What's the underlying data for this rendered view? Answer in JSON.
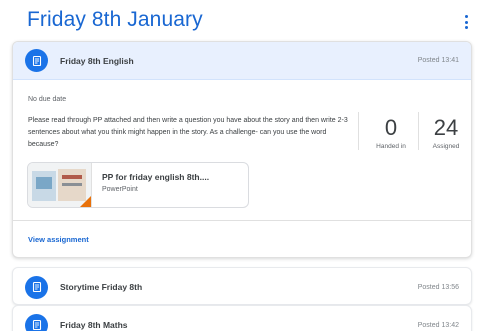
{
  "topic": {
    "title": "Friday 8th January"
  },
  "expanded_assignment": {
    "title": "Friday 8th English",
    "posted": "Posted 13:41",
    "due": "No due date",
    "instructions": "Please read through PP attached and then write a question you have about the story and then write 2-3 sentences about what you think might happen in the story. As a challenge- can you use the word because?",
    "handed_in_count": "0",
    "handed_in_label": "Handed in",
    "assigned_count": "24",
    "assigned_label": "Assigned",
    "attachment": {
      "title": "PP for friday english 8th....",
      "type": "PowerPoint"
    },
    "view_label": "View assignment"
  },
  "assignments": [
    {
      "title": "Storytime Friday 8th",
      "posted": "Posted 13:56"
    },
    {
      "title": "Friday 8th Maths",
      "posted": "Posted 13:42"
    }
  ],
  "colors": {
    "accent": "#1967d2",
    "icon_bg": "#1a73e8",
    "header_bg": "#e8f0fe"
  },
  "icons": {
    "assignment": "assignment-icon",
    "more": "more-vert-icon"
  }
}
